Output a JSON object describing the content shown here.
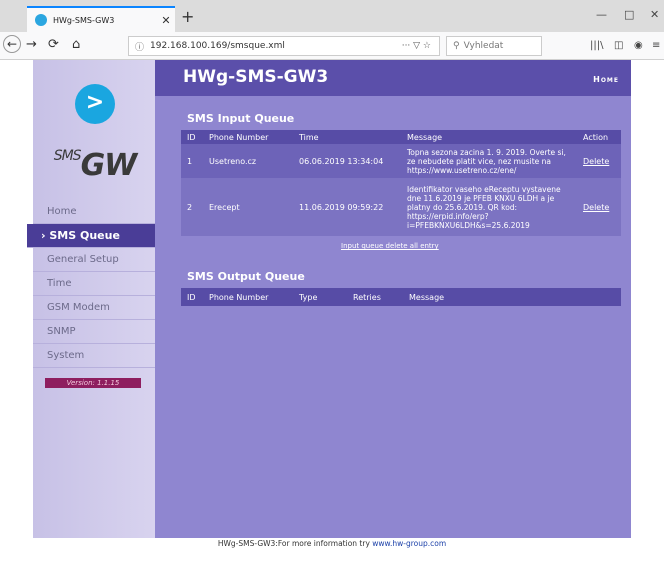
{
  "browser": {
    "tab_title": "HWg-SMS-GW3",
    "tab_close": "✕",
    "new_tab": "+",
    "url": "192.168.100.169/smsque.xml",
    "url_actions": "··· ▽ ☆",
    "search_placeholder": "Vyhledat",
    "minimize": "—",
    "maximize": "□",
    "close": "✕"
  },
  "sidebar": {
    "logo_mark": ">",
    "logo_sms": "SMS",
    "logo_gw": "GW",
    "items": [
      {
        "label": "Home"
      },
      {
        "label": "› SMS Queue"
      },
      {
        "label": "General Setup"
      },
      {
        "label": "Time"
      },
      {
        "label": "GSM Modem"
      },
      {
        "label": "SNMP"
      },
      {
        "label": "System"
      }
    ],
    "version": "Version: 1.1.15"
  },
  "header": {
    "title": "HWg-SMS-GW3",
    "home_link": "Home"
  },
  "input_queue": {
    "title": "SMS Input Queue",
    "columns": [
      "ID",
      "Phone Number",
      "Time",
      "Message",
      "Action"
    ],
    "rows": [
      {
        "id": "1",
        "phone": "Usetreno.cz",
        "time": "06.06.2019 13:34:04",
        "message": "Topna sezona zacina 1. 9. 2019. Overte si, ze nebudete platit vice, nez musite na https://www.usetreno.cz/ene/",
        "action": "Delete"
      },
      {
        "id": "2",
        "phone": "Erecept",
        "time": "11.06.2019 09:59:22",
        "message": "Identifikator vaseho eReceptu vystavene dne 11.6.2019 je PFEB KNXU 6LDH a je platny do 25.6.2019. QR kod: https://erpid.info/erp?i=PFEBKNXU6LDH&s=25.6.2019",
        "action": "Delete"
      }
    ],
    "delete_all": "Input queue delete all entry"
  },
  "output_queue": {
    "title": "SMS Output Queue",
    "columns": [
      "ID",
      "Phone Number",
      "Type",
      "Retries",
      "Message"
    ]
  },
  "footer": {
    "text": "HWg-SMS-GW3:For more information try ",
    "link": "www.hw-group.com"
  }
}
